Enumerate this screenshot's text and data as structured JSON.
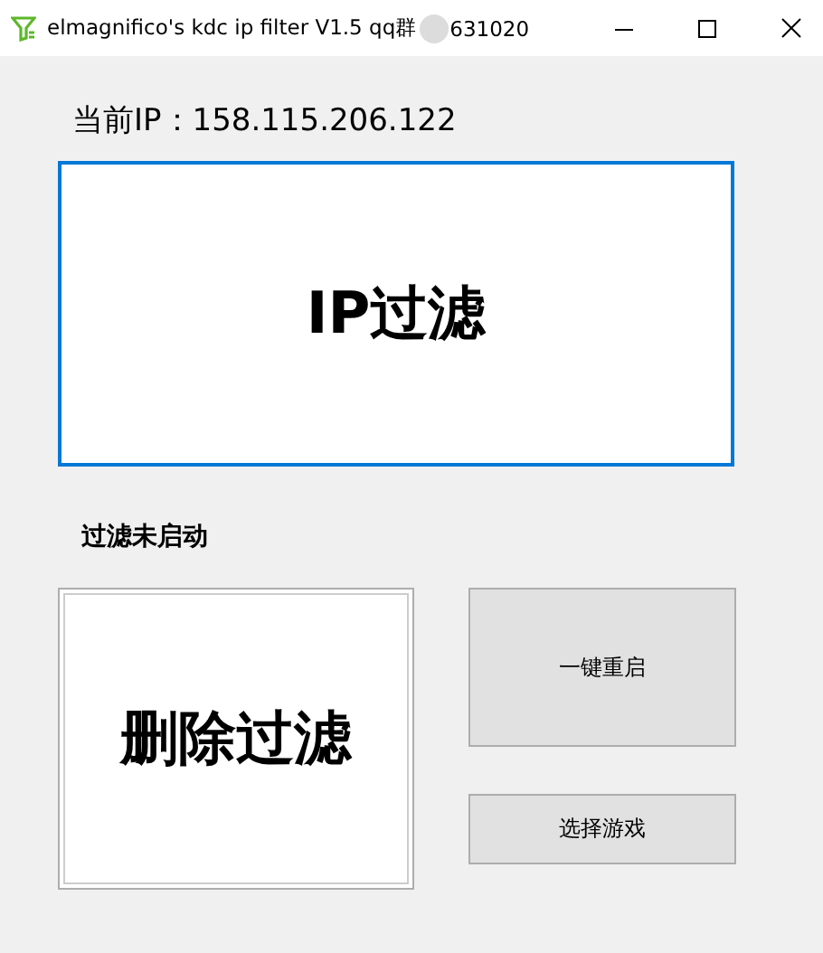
{
  "window": {
    "title": "elmagnifico's kdc ip filter V1.5 qq群",
    "title_tail": "631020"
  },
  "current_ip": {
    "label": "当前IP：",
    "value": "158.115.206.122"
  },
  "filter_button": {
    "label": "IP过滤",
    "focused": true
  },
  "status": "过滤未启动",
  "remove_button": {
    "label": "删除过滤"
  },
  "restart_button": {
    "label": "一键重启"
  },
  "game_button": {
    "label": "选择游戏"
  }
}
